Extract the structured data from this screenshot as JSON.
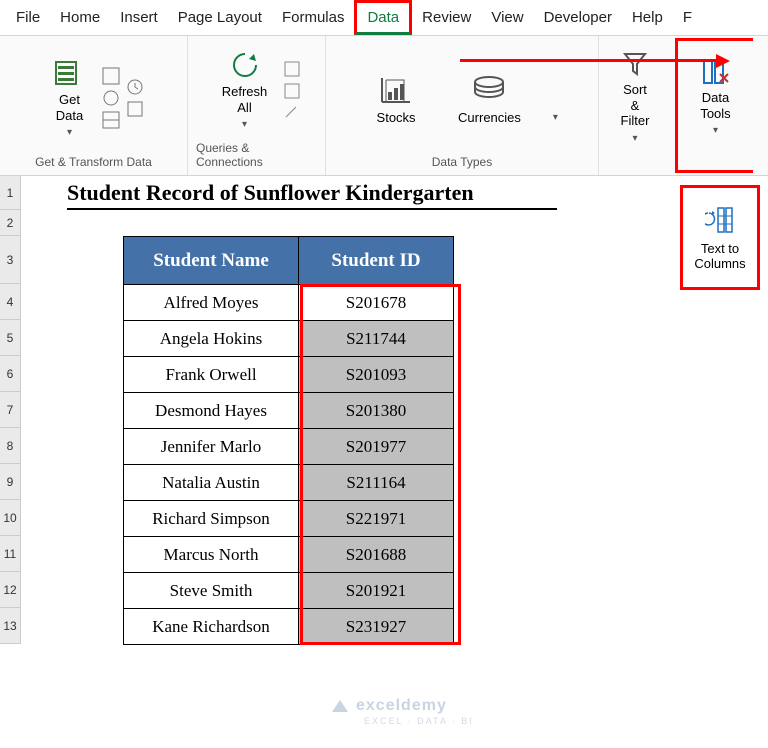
{
  "menu": [
    "File",
    "Home",
    "Insert",
    "Page Layout",
    "Formulas",
    "Data",
    "Review",
    "View",
    "Developer",
    "Help",
    "F"
  ],
  "menu_active_index": 5,
  "ribbon": [
    {
      "label": "Get & Transform Data",
      "btns": [
        {
          "name": "get-data",
          "label": "Get\nData"
        }
      ]
    },
    {
      "label": "Queries & Connections",
      "btns": [
        {
          "name": "refresh-all",
          "label": "Refresh\nAll"
        }
      ]
    },
    {
      "label": "Data Types",
      "btns": [
        {
          "name": "stocks",
          "label": "Stocks"
        },
        {
          "name": "currencies",
          "label": "Currencies"
        }
      ]
    },
    {
      "label": "",
      "btns": [
        {
          "name": "sort-filter",
          "label": "Sort &\nFilter"
        }
      ]
    },
    {
      "label": "",
      "btns": [
        {
          "name": "data-tools",
          "label": "Data\nTools"
        }
      ]
    }
  ],
  "popover": {
    "label": "Text to\nColumns"
  },
  "title": "Student Record of Sunflower Kindergarten",
  "headers": {
    "name": "Student Name",
    "id": "Student ID"
  },
  "rows": [
    {
      "name": "Alfred Moyes",
      "id": "S201678"
    },
    {
      "name": "Angela Hokins",
      "id": "S211744"
    },
    {
      "name": "Frank Orwell",
      "id": "S201093"
    },
    {
      "name": "Desmond Hayes",
      "id": "S201380"
    },
    {
      "name": "Jennifer Marlo",
      "id": "S201977"
    },
    {
      "name": "Natalia Austin",
      "id": "S211164"
    },
    {
      "name": "Richard Simpson",
      "id": "S221971"
    },
    {
      "name": "Marcus North",
      "id": "S201688"
    },
    {
      "name": "Steve Smith",
      "id": "S201921"
    },
    {
      "name": "Kane Richardson",
      "id": "S231927"
    }
  ],
  "row_numbers": [
    "1",
    "2",
    "3",
    "4",
    "5",
    "6",
    "7",
    "8",
    "9",
    "10",
    "11",
    "12",
    "13"
  ],
  "watermark": {
    "main": "exceldemy",
    "sub": "EXCEL · DATA · BI"
  }
}
